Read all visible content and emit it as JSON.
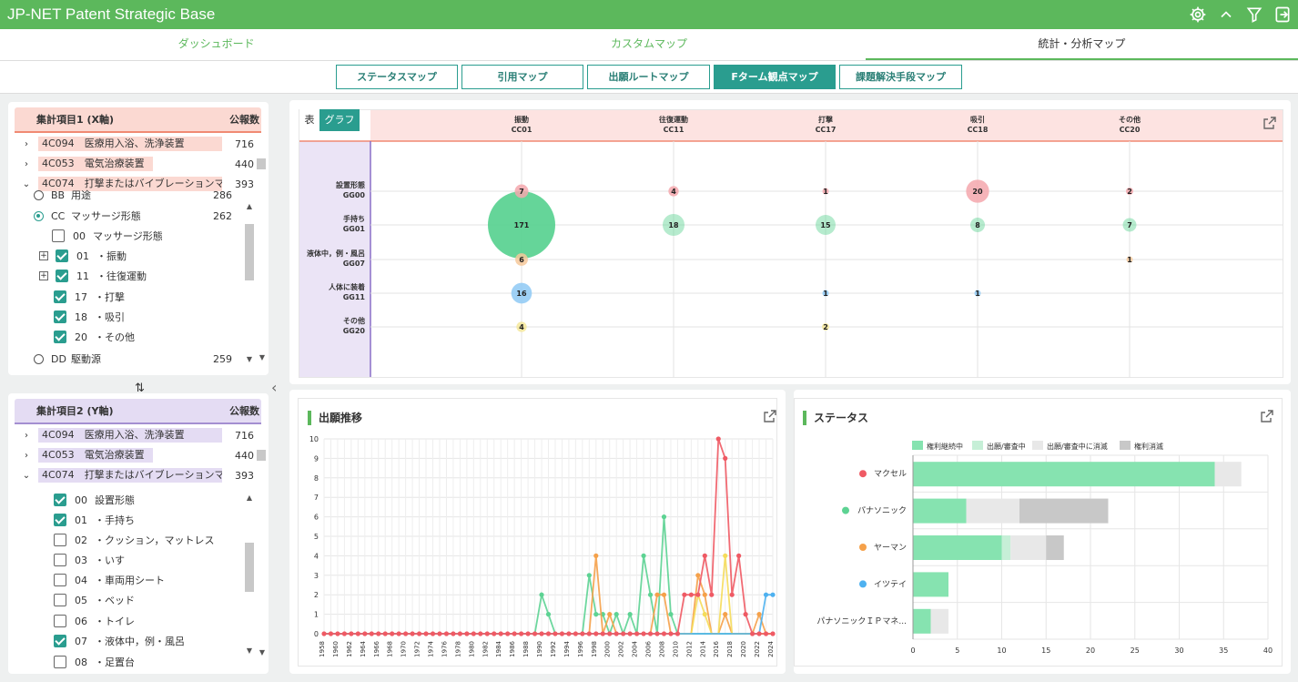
{
  "app": {
    "title": "JP-NET Patent Strategic Base"
  },
  "header_icons": [
    "gear-icon",
    "chevron-up-icon",
    "filter-icon",
    "logout-icon"
  ],
  "main_tabs": [
    {
      "label": "ダッシュボード",
      "active": false
    },
    {
      "label": "カスタムマップ",
      "active": false
    },
    {
      "label": "統計・分析マップ",
      "active": true
    }
  ],
  "sub_tabs": [
    {
      "label": "ステータスマップ",
      "active": false
    },
    {
      "label": "引用マップ",
      "active": false
    },
    {
      "label": "出願ルートマップ",
      "active": false
    },
    {
      "label": "Fターム観点マップ",
      "active": true
    },
    {
      "label": "課題解決手段マップ",
      "active": false
    }
  ],
  "x_axis_panel": {
    "header_label": "集計項目1 (X軸)",
    "header_count": "公報数",
    "top_items": [
      {
        "code": "4C094",
        "name": "医療用入浴、洗浄装置",
        "count": "716",
        "arrow": "›"
      },
      {
        "code": "4C053",
        "name": "電気治療装置",
        "count": "440",
        "arrow": "›"
      },
      {
        "code": "4C074",
        "name": "打撃またはバイブレーションマ...",
        "count": "393",
        "arrow": "⌄"
      }
    ],
    "partial_top": {
      "code": "BB",
      "name": "用途",
      "count": "286"
    },
    "sub_items": [
      {
        "kind": "radio",
        "selected": true,
        "code": "CC",
        "name": "マッサージ形態",
        "count": "262"
      },
      {
        "kind": "check",
        "checked": false,
        "code": "00",
        "name": "マッサージ形態"
      },
      {
        "kind": "check",
        "checked": true,
        "expand": "⊞",
        "code": "01",
        "name": "・振動"
      },
      {
        "kind": "check",
        "checked": true,
        "expand": "⊞",
        "code": "11",
        "name": "・往復運動"
      },
      {
        "kind": "check",
        "checked": true,
        "code": "17",
        "name": "・打撃"
      },
      {
        "kind": "check",
        "checked": true,
        "code": "18",
        "name": "・吸引"
      },
      {
        "kind": "check",
        "checked": true,
        "code": "20",
        "name": "・その他"
      },
      {
        "kind": "radio",
        "selected": false,
        "code": "DD",
        "name": "駆動源",
        "count": "259"
      }
    ]
  },
  "swap_icon": "⇅",
  "collapse_icon": "‹",
  "y_axis_panel": {
    "header_label": "集計項目2 (Y軸)",
    "header_count": "公報数",
    "top_items": [
      {
        "code": "4C094",
        "name": "医療用入浴、洗浄装置",
        "count": "716",
        "arrow": "›"
      },
      {
        "code": "4C053",
        "name": "電気治療装置",
        "count": "440",
        "arrow": "›"
      },
      {
        "code": "4C074",
        "name": "打撃またはバイブレーションマ...",
        "count": "393",
        "arrow": "⌄"
      }
    ],
    "sub_items": [
      {
        "checked": true,
        "code": "00",
        "name": "設置形態"
      },
      {
        "checked": true,
        "code": "01",
        "name": "・手持ち"
      },
      {
        "checked": false,
        "code": "02",
        "name": "・クッション，マットレス"
      },
      {
        "checked": false,
        "code": "03",
        "name": "・いす"
      },
      {
        "checked": false,
        "code": "04",
        "name": "・車両用シート"
      },
      {
        "checked": false,
        "code": "05",
        "name": "・ベッド"
      },
      {
        "checked": false,
        "code": "06",
        "name": "・トイレ"
      },
      {
        "checked": true,
        "code": "07",
        "name": "・液体中，例・風呂"
      },
      {
        "checked": false,
        "code": "08",
        "name": "・足置台"
      }
    ]
  },
  "bubble_map": {
    "toggle_table": "表",
    "toggle_graph": "グラフ",
    "columns": [
      {
        "name": "振動",
        "code": "CC01"
      },
      {
        "name": "往復運動",
        "code": "CC11"
      },
      {
        "name": "打撃",
        "code": "CC17"
      },
      {
        "name": "吸引",
        "code": "CC18"
      },
      {
        "name": "その他",
        "code": "CC20"
      }
    ],
    "rows": [
      {
        "name": "設置形態",
        "code": "GG00",
        "color": "#f4a7ad"
      },
      {
        "name": "手持ち",
        "code": "GG01",
        "color": "#5dd393"
      },
      {
        "name": "液体中，例・風呂",
        "code": "GG07",
        "color": "#f6c89a"
      },
      {
        "name": "人体に装着",
        "code": "GG11",
        "color": "#8ec9f4"
      },
      {
        "name": "その他",
        "code": "GG20",
        "color": "#f4e79a"
      }
    ],
    "cells": [
      {
        "r": 0,
        "c": 0,
        "v": 7
      },
      {
        "r": 0,
        "c": 1,
        "v": 4
      },
      {
        "r": 0,
        "c": 2,
        "v": 1
      },
      {
        "r": 0,
        "c": 3,
        "v": 20
      },
      {
        "r": 0,
        "c": 4,
        "v": 2
      },
      {
        "r": 1,
        "c": 0,
        "v": 171
      },
      {
        "r": 1,
        "c": 1,
        "v": 18
      },
      {
        "r": 1,
        "c": 2,
        "v": 15
      },
      {
        "r": 1,
        "c": 3,
        "v": 8
      },
      {
        "r": 1,
        "c": 4,
        "v": 7
      },
      {
        "r": 2,
        "c": 0,
        "v": 6
      },
      {
        "r": 2,
        "c": 4,
        "v": 1
      },
      {
        "r": 3,
        "c": 0,
        "v": 16
      },
      {
        "r": 3,
        "c": 2,
        "v": 1
      },
      {
        "r": 3,
        "c": 3,
        "v": 1
      },
      {
        "r": 4,
        "c": 0,
        "v": 4
      },
      {
        "r": 4,
        "c": 2,
        "v": 2
      }
    ]
  },
  "chart_data": [
    {
      "type": "line",
      "title": "出願推移",
      "ylim": [
        0,
        10
      ],
      "x_start": 1958,
      "x_end": 2024,
      "x": [
        1958,
        1959,
        1960,
        1961,
        1962,
        1963,
        1964,
        1965,
        1966,
        1967,
        1968,
        1969,
        1970,
        1971,
        1972,
        1973,
        1974,
        1975,
        1976,
        1977,
        1978,
        1979,
        1980,
        1981,
        1982,
        1983,
        1984,
        1985,
        1986,
        1987,
        1988,
        1989,
        1990,
        1991,
        1992,
        1993,
        1994,
        1995,
        1996,
        1997,
        1998,
        1999,
        2000,
        2001,
        2002,
        2003,
        2004,
        2005,
        2006,
        2007,
        2008,
        2009,
        2010,
        2011,
        2012,
        2013,
        2014,
        2015,
        2016,
        2017,
        2018,
        2019,
        2020,
        2021,
        2022,
        2023,
        2024
      ],
      "x_tick_labels": [
        "1958",
        "1960",
        "1962",
        "1964",
        "1966",
        "1968",
        "1970",
        "1972",
        "1974",
        "1976",
        "1978",
        "1980",
        "1982",
        "1984",
        "1986",
        "1988",
        "1990",
        "1992",
        "1994",
        "1996",
        "1998",
        "2000",
        "2002",
        "2004",
        "2006",
        "2008",
        "2010",
        "2012",
        "2014",
        "2016",
        "2018",
        "2020",
        "2022",
        "2024"
      ],
      "series": [
        {
          "name": "パナソニック",
          "color": "#5dd393",
          "points": {
            "1990": 2,
            "1991": 1,
            "1997": 3,
            "1998": 1,
            "1999": 1,
            "2001": 1,
            "2003": 1,
            "2005": 4,
            "2006": 2,
            "2008": 6,
            "2009": 1
          }
        },
        {
          "name": "ヤーマン",
          "color": "#f5a14a",
          "points": {
            "1998": 4,
            "2000": 1,
            "2007": 2,
            "2008": 2,
            "2013": 3,
            "2014": 2,
            "2017": 1,
            "2022": 1
          }
        },
        {
          "name": "パナソニックＩＰマネ...",
          "color": "#f5dc5a",
          "points": {
            "2013": 2,
            "2014": 1,
            "2017": 4
          }
        },
        {
          "name": "イツテイ",
          "color": "#4eb1f0",
          "points": {
            "2023": 2,
            "2024": 2
          }
        },
        {
          "name": "マクセル",
          "color": "#ef5a64",
          "points": {
            "2011": 2,
            "2012": 2,
            "2013": 2,
            "2014": 4,
            "2015": 2,
            "2016": 10,
            "2017": 9,
            "2018": 2,
            "2019": 4,
            "2020": 1
          }
        }
      ]
    },
    {
      "type": "bar",
      "title": "ステータス",
      "stacked": true,
      "orientation": "horizontal",
      "categories": [
        "マクセル",
        "パナソニック",
        "ヤーマン",
        "イツテイ",
        "パナソニックＩＰマネ..."
      ],
      "category_colors": [
        "#ef5a64",
        "#5dd393",
        "#f5a14a",
        "#4eb1f0",
        "#f5dc5a"
      ],
      "xlim": [
        0,
        40
      ],
      "x_ticks": [
        "0",
        "5",
        "10",
        "15",
        "20",
        "25",
        "30",
        "35",
        "40"
      ],
      "legend_position": "top",
      "series": [
        {
          "name": "権利継続中",
          "color": "#86e3b0",
          "values": [
            34,
            6,
            10,
            4,
            2
          ]
        },
        {
          "name": "出願/審査中",
          "color": "#c6efd7",
          "values": [
            0,
            0,
            1,
            0,
            0
          ]
        },
        {
          "name": "出願/審査中に消滅",
          "color": "#e8e8e8",
          "values": [
            3,
            6,
            4,
            0,
            2
          ]
        },
        {
          "name": "権利消滅",
          "color": "#c8c8c8",
          "values": [
            0,
            10,
            2,
            0,
            0
          ]
        }
      ]
    }
  ]
}
